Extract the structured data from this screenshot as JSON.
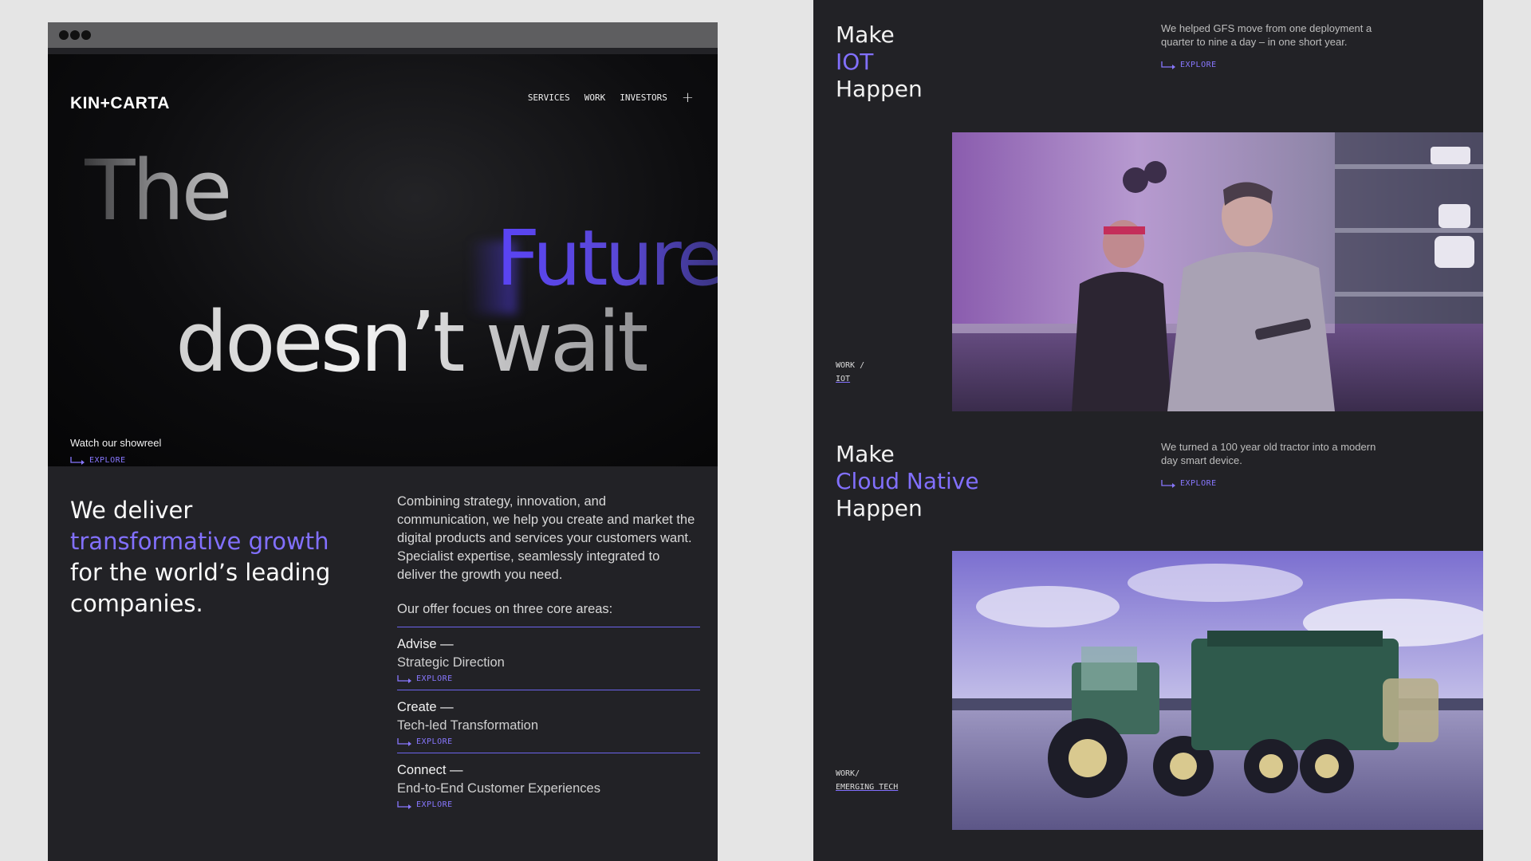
{
  "left": {
    "logo": "KIN+CARTA",
    "nav": [
      "SERVICES",
      "WORK",
      "INVESTORS"
    ],
    "nav_plus": "+",
    "hero": {
      "line1": "The",
      "line2": "Future",
      "line3": "doesn’t wait",
      "showreel": "Watch our showreel",
      "explore": "EXPLORE"
    },
    "intro": {
      "heading_pre": "We deliver ",
      "heading_accent": "transformative growth",
      "heading_post": " for the world’s leading companies.",
      "body": "Combining strategy, innovation, and communication, we help you create and market the digital products and services your customers want. Specialist expertise, seamlessly integrated to deliver the growth you need.",
      "offer_intro": "Our offer focues on three core areas:"
    },
    "offers": [
      {
        "title": "Advise —",
        "subtitle": "Strategic Direction",
        "explore": "EXPLORE"
      },
      {
        "title": "Create —",
        "subtitle": "Tech-led Transformation",
        "explore": "EXPLORE"
      },
      {
        "title": "Connect —",
        "subtitle": "End-to-End Customer Experiences",
        "explore": "EXPLORE"
      }
    ]
  },
  "right": {
    "iot": {
      "make": "Make",
      "accent": "IOT",
      "happen": "Happen",
      "desc": "We helped GFS move from one deployment a quarter to nine a day – in one short year.",
      "explore": "EXPLORE",
      "crumb1": "WORK  /",
      "crumb2": "IOT"
    },
    "cloud": {
      "make": "Make",
      "accent": "Cloud Native",
      "happen": "Happen",
      "desc": "We turned a 100 year old tractor into a modern day smart device.",
      "explore": "EXPLORE",
      "crumb1": "WORK/",
      "crumb2": "EMERGING TECH"
    }
  },
  "colors": {
    "accent": "#8270ff",
    "dark_bg": "#222226",
    "page_bg": "#e5e5e5"
  }
}
